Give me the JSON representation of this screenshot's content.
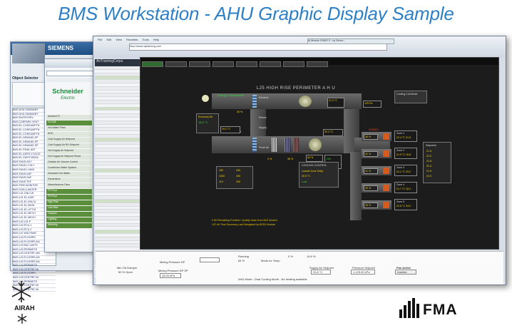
{
  "title": "BMS Workstation - AHU Graphic Display Sample",
  "siemens_window": {
    "brand": "SIEMENS",
    "object_selector_label": "Object Selector",
    "objects_list": [
      "BMS.AHU.SUMMARY",
      "BMS.AHU.SUMMARY",
      "BMS.ENTRY.REV",
      "BMS.CARPARK.VENT",
      "BMS.EL.CONSUMPTN",
      "BMS.EL.CONSUMPTN",
      "BMS.EL.CONSUMPTN",
      "BMS.EL.DEMAND.SP",
      "BMS.EL.DEMAND.SP",
      "BMS.EL.DEMAND.SP",
      "BMS.EL.PEAK.ADT",
      "BMS.EL.ADRS.V.SCHD",
      "BMS.EL.SWITCHBOA",
      "BMS.FANS.ADY",
      "BMS.FANS.LY.DLY",
      "BMS.FANS.L.MAR",
      "BMS.FANS.ADF",
      "BMS.FANS.SAF",
      "BMS.FANS.TEF",
      "BMS.FIRE.MONITOR",
      "BMS.GAS.&.WATER",
      "BMS.L01.ONLY.W",
      "BMS.L01.EL.AGIE",
      "BMS.L01.EL.AHU.A",
      "BMS.L01.EL.MAIN",
      "BMS.L01.EL.LIFT.M",
      "BMS.L01.EL.MECH",
      "BMS.L01.EL.MECH",
      "BMS.L02.L01.P",
      "BMS.L02.PCU.1",
      "BMS.L03.PCU.2",
      "BMS.L07.MID.PANE",
      "BMS.L03.FLOORPL",
      "BMS.L03.FLOORPLAN",
      "BMS.L03.PAC.UNITS",
      "BMS.L03.PERIMETE",
      "BMS.L03.CENTRE.VAV",
      "BMS.L03.FLOORPLAN",
      "BMS.L03.FLOORPLAN",
      "BMS.L04.PERIMETE",
      "BMS.L04.CENTRE.VA",
      "BMS.L05.FLOORPL",
      "BMS.L05.CENTRE.VA",
      "BMS.L05.PERIMETE",
      "BMS.L06.CENTRE.VA",
      "BMS.L06.CENTRE.VA"
    ]
  },
  "schneider_window": {
    "brand": "Schneider",
    "brand_sub": "Electric",
    "menu": [
      {
        "label": "Ambient FI",
        "active": false
      },
      {
        "label": "CLChill",
        "active": true
      },
      {
        "label": "Hot Water Plant",
        "active": false
      },
      {
        "label": "AHU",
        "active": false
      },
      {
        "label": "Cold Supply Air Setpoint",
        "active": false
      },
      {
        "label": "Cold Supply Air RH Setpoint",
        "active": false
      },
      {
        "label": "Hot Supply Air Setpoint",
        "active": false
      },
      {
        "label": "Hot Supply Air Setpoint Reset",
        "active": false
      },
      {
        "label": "Outside Air Volume Control",
        "active": false
      },
      {
        "label": "Condenser Water System",
        "active": false
      },
      {
        "label": "Domestic Hot Water",
        "active": false
      },
      {
        "label": "Generators",
        "active": false
      },
      {
        "label": "Miscellaneous Fans",
        "active": false
      },
      {
        "label": "P2 Floor",
        "active": true
      },
      {
        "label": "P3 Floor",
        "active": true
      },
      {
        "label": "High Rise",
        "active": true
      },
      {
        "label": "Low-Rise",
        "active": true
      },
      {
        "label": "Carpark",
        "active": true
      },
      {
        "label": "Lighting",
        "active": true
      },
      {
        "label": "Metering",
        "active": true
      }
    ]
  },
  "browser": {
    "menu": [
      "File",
      "Edit",
      "View",
      "Favorites",
      "Tools",
      "Help"
    ],
    "url_text": "http://www.ajtraining.com",
    "tab_title": "M-Module 5 BMS S - by Schne...",
    "left_pane_title": "AirTrainingCorps",
    "bottom_buttons": [
      "BAS",
      "SYS",
      "CMD",
      "CFG"
    ]
  },
  "ahu_screen": {
    "title": "L25 HIGH RISE PERIMETER A H U",
    "energy_consumption": "Energy Consumption",
    "outside_temp": "18.8 °C",
    "outside_air_damper": "Economy Air",
    "labels": [
      "Exhaust",
      "Return",
      "Supply",
      "Fresh Air"
    ],
    "setpoints": {
      "supply_temp": "20.4 °C",
      "return_temp": "21.3 °C",
      "mixed_temp": "19.2 °C",
      "fan_speed": "84 %",
      "pressure": "125 Pa"
    },
    "damper_positions": [
      "26 %",
      "0 %",
      "100 %"
    ],
    "heating_valve": "0 %",
    "cooling_valve": "46 %",
    "fan_status": "ON",
    "static_pressure_label": "Cooling Coil Mode",
    "cooling_control": {
      "title": "COOLING CONTROL",
      "mode": "Lowest Zone Setpt",
      "setpoint": "20.5 °C",
      "status": "Low"
    },
    "zone_header": "ZONES",
    "zones": [
      {
        "name": "Zone 1",
        "temp": "22.4 °C",
        "damper": "36 %",
        "flow": "21.5"
      },
      {
        "name": "Zone 2",
        "temp": "21.9 °C",
        "damper": "32 %",
        "flow": "19.8"
      },
      {
        "name": "Zone 3",
        "temp": "22.1 °C",
        "damper": "41 %",
        "flow": "23.2"
      },
      {
        "name": "Zone 4",
        "temp": "21.7 °C",
        "damper": "28 %",
        "flow": "18.4"
      },
      {
        "name": "Zone 5",
        "temp": "22.6 °C",
        "damper": "45 %",
        "flow": "24.0"
      }
    ],
    "zone_summary_title": "Setpoints",
    "zone_summary": [
      "21.5",
      "22.0",
      "21.8",
      "22.4",
      "21.9",
      "22.3"
    ],
    "status_text_1": "0.50 Remaining Runtime / Quality down from BLE Module",
    "status_text_2": "147.4h Time Summary Last Delegated by BCB1 Module",
    "zone_box_values": [
      "200",
      "250",
      "1000",
      "250",
      "110",
      "340"
    ]
  },
  "bottom_panel": {
    "fields": [
      {
        "label": "Min OA Damper",
        "value": "50 % Open"
      },
      {
        "label": "Mixing Pressure DP",
        "value": ""
      },
      {
        "label": "Mixing Pressure DP SP",
        "value": "15.00 kPa"
      },
      {
        "label": "Running",
        "value": "84 %"
      },
      {
        "label": "Mode for Temp",
        "value": ""
      },
      {
        "label": "Supply Air Setpoint",
        "value": "23.8 °C"
      },
      {
        "label": "Pressure Setpoint",
        "value": "1,125.00 kPa"
      },
      {
        "label": "Fan Active",
        "value": "Inactive"
      }
    ],
    "mode_text": "AHU Mode : Dual Cooling Mode - No heating available",
    "percent_1": "0 %",
    "percent_2": "14.8 %"
  },
  "logos": {
    "left": "AIRAH",
    "right": "FMA"
  }
}
